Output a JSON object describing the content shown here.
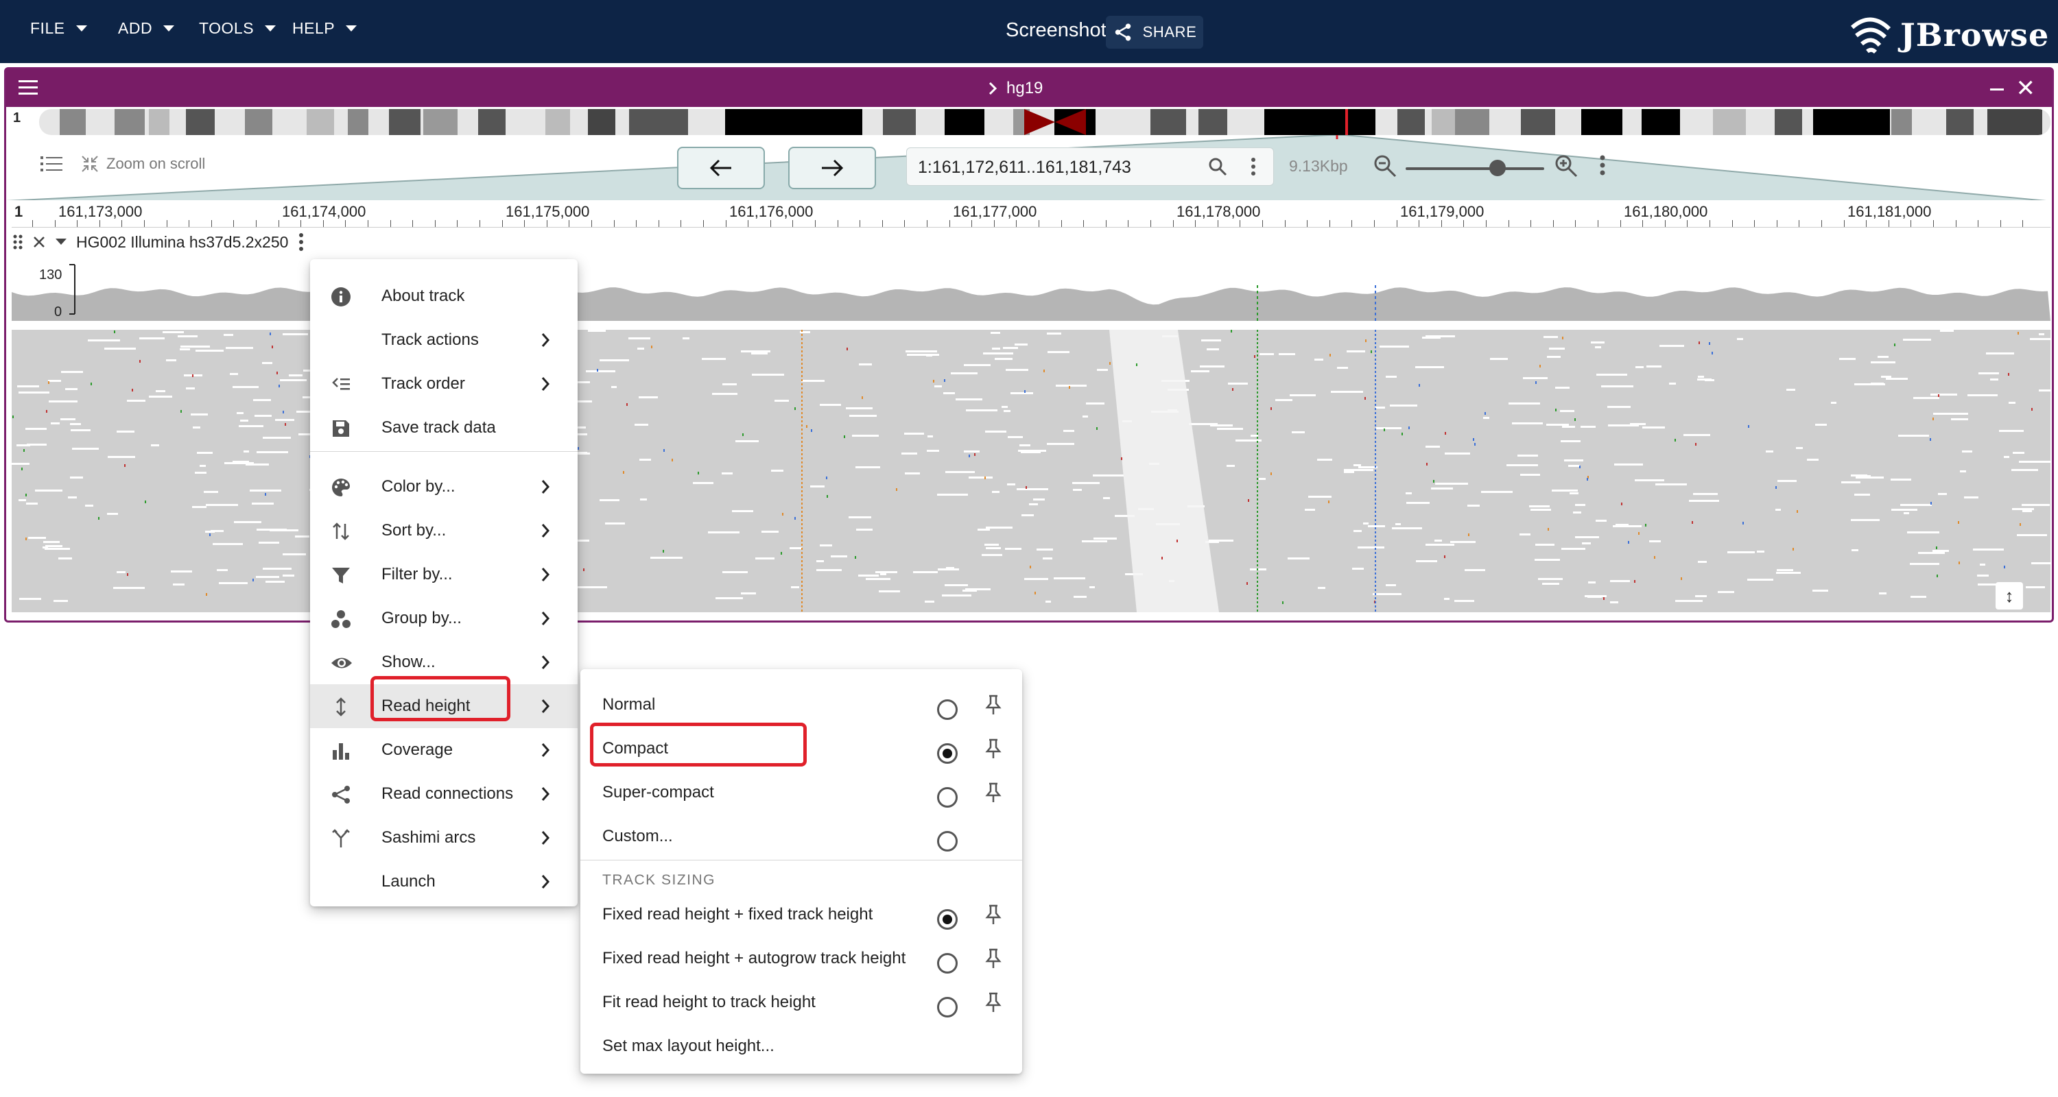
{
  "appbar": {
    "menus": [
      "FILE",
      "ADD",
      "TOOLS",
      "HELP"
    ],
    "title": "Screenshot",
    "share_label": "SHARE",
    "logo_text": "JBrowse"
  },
  "view": {
    "assembly": "hg19",
    "chromosome_label": "1",
    "zoom_on_scroll_label": "Zoom on scroll",
    "location": "1:161,172,611..161,181,743",
    "bp_per_view": "9.13Kbp",
    "ruler": {
      "chrom": "1",
      "ticks": [
        "161,173,000",
        "161,174,000",
        "161,175,000",
        "161,176,000",
        "161,177,000",
        "161,178,000",
        "161,179,000",
        "161,180,000",
        "161,181,000"
      ]
    }
  },
  "track": {
    "name": "HG002 Illumina hs37d5.2x250",
    "coverage_max": "130",
    "coverage_min": "0"
  },
  "track_menu": {
    "items": [
      {
        "label": "About track",
        "icon": "info-icon",
        "submenu": false
      },
      {
        "label": "Track actions",
        "icon": "",
        "submenu": true
      },
      {
        "label": "Track order",
        "icon": "track-order-icon",
        "submenu": true
      },
      {
        "label": "Save track data",
        "icon": "save-icon",
        "submenu": false
      },
      {
        "label": "Color by...",
        "icon": "palette-icon",
        "submenu": true
      },
      {
        "label": "Sort by...",
        "icon": "sort-icon",
        "submenu": true
      },
      {
        "label": "Filter by...",
        "icon": "filter-icon",
        "submenu": true
      },
      {
        "label": "Group by...",
        "icon": "group-icon",
        "submenu": true
      },
      {
        "label": "Show...",
        "icon": "eye-icon",
        "submenu": true
      },
      {
        "label": "Read height",
        "icon": "vertical-arrows-icon",
        "submenu": true
      },
      {
        "label": "Coverage",
        "icon": "bar-chart-icon",
        "submenu": true
      },
      {
        "label": "Read connections",
        "icon": "share-icon",
        "submenu": true
      },
      {
        "label": "Sashimi arcs",
        "icon": "fork-icon",
        "submenu": true
      },
      {
        "label": "Launch",
        "icon": "",
        "submenu": true
      }
    ]
  },
  "read_height_menu": {
    "options": [
      {
        "label": "Normal",
        "selected": false,
        "pin": true
      },
      {
        "label": "Compact",
        "selected": true,
        "pin": true
      },
      {
        "label": "Super-compact",
        "selected": false,
        "pin": true
      },
      {
        "label": "Custom...",
        "selected": false,
        "pin": false
      }
    ],
    "section_title": "TRACK SIZING",
    "sizing_options": [
      {
        "label": "Fixed read height + fixed track height",
        "selected": true,
        "pin": true
      },
      {
        "label": "Fixed read height + autogrow track height",
        "selected": false,
        "pin": true
      },
      {
        "label": "Fit read height to track height",
        "selected": false,
        "pin": true
      }
    ],
    "footer_item": "Set max layout height..."
  },
  "colors": {
    "appbar": "#0d2446",
    "view_header": "#781c66",
    "highlight": "#e0202a",
    "reads": "#cfcfcf",
    "coverage": "#b5b5b5"
  }
}
